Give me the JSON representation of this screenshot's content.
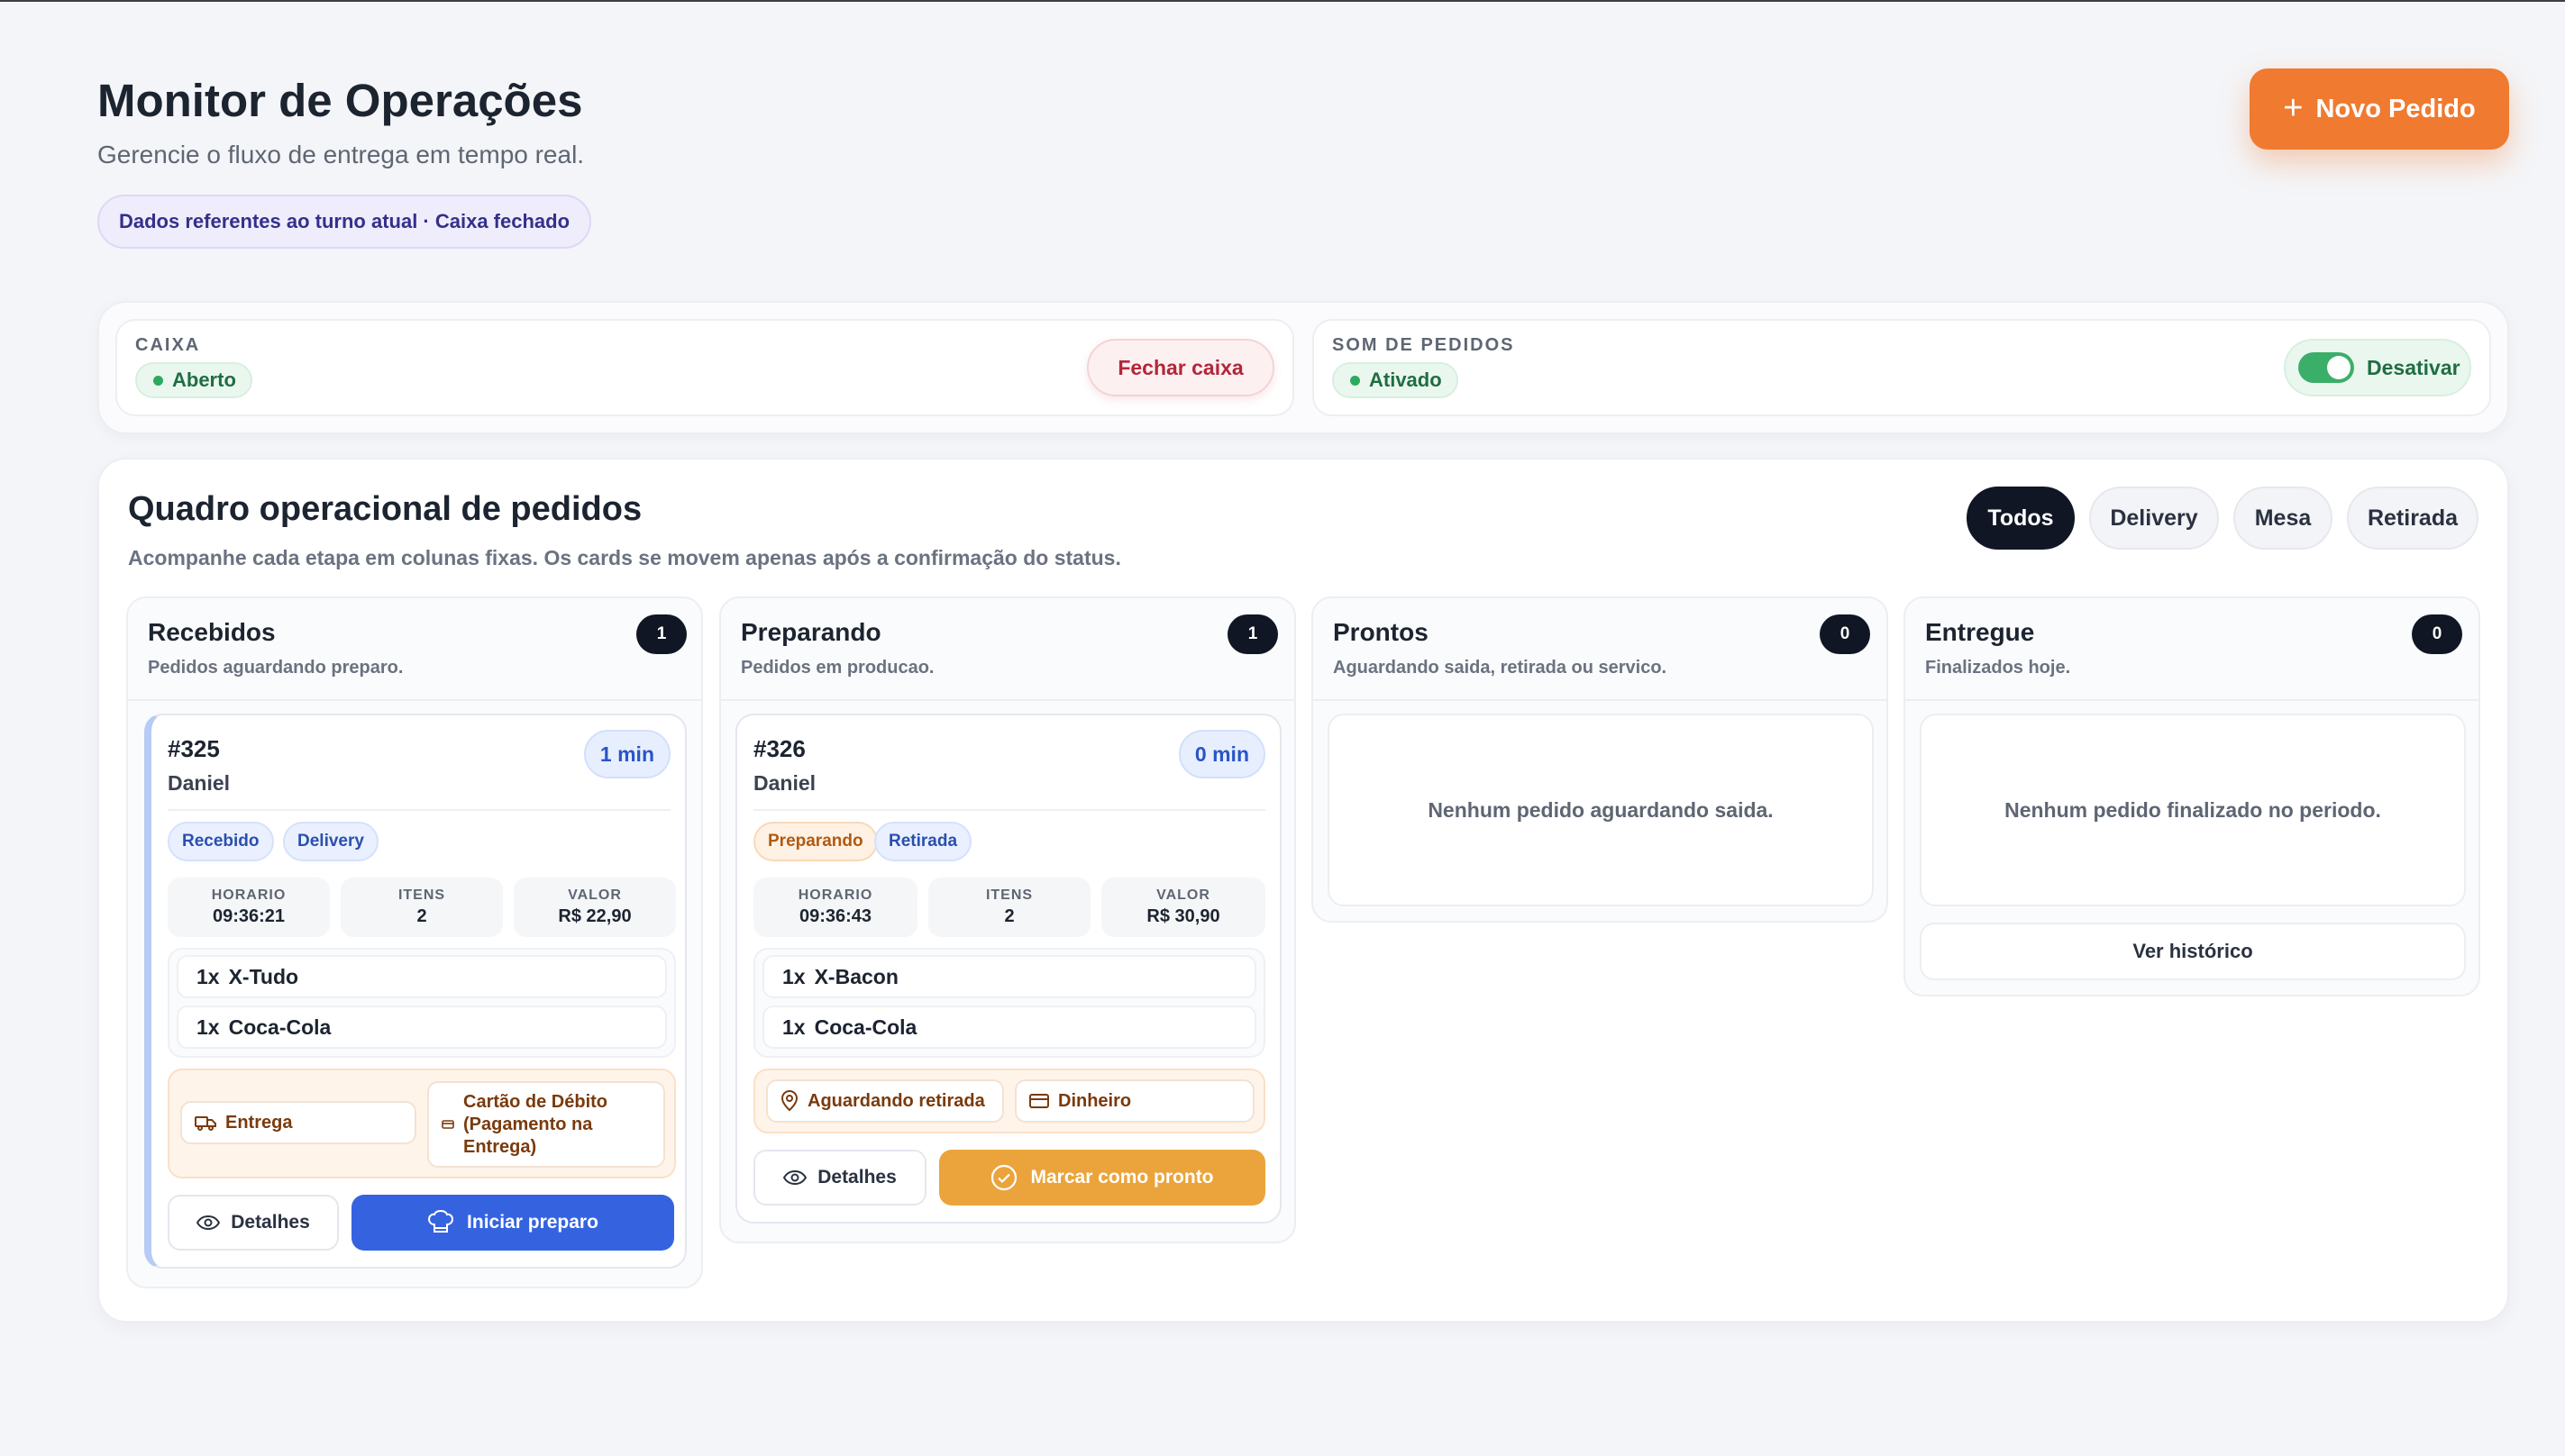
{
  "header": {
    "title": "Monitor de Operações",
    "subtitle": "Gerencie o fluxo de entrega em tempo real.",
    "shift_info": "Dados referentes ao turno atual · Caixa fechado",
    "new_order_label": "Novo Pedido"
  },
  "status": {
    "cash": {
      "label": "CAIXA",
      "state": "Aberto",
      "action_label": "Fechar caixa"
    },
    "sound": {
      "label": "SOM DE PEDIDOS",
      "state": "Ativado",
      "toggle_on": true,
      "action_label": "Desativar"
    }
  },
  "board": {
    "title": "Quadro operacional de pedidos",
    "subtitle": "Acompanhe cada etapa em colunas fixas. Os cards se movem apenas após a confirmação do status.",
    "filters": [
      {
        "label": "Todos",
        "active": true
      },
      {
        "label": "Delivery",
        "active": false
      },
      {
        "label": "Mesa",
        "active": false
      },
      {
        "label": "Retirada",
        "active": false
      }
    ],
    "columns": [
      {
        "title": "Recebidos",
        "subtitle": "Pedidos aguardando preparo.",
        "count": "1",
        "orders": [
          {
            "id": "#325",
            "customer": "Daniel",
            "elapsed": "1 min",
            "status_tag": "Recebido",
            "type_tag": "Delivery",
            "metrics": [
              {
                "label": "HORARIO",
                "value": "09:36:21"
              },
              {
                "label": "ITENS",
                "value": "2"
              },
              {
                "label": "VALOR",
                "value": "R$ 22,90"
              }
            ],
            "items": [
              {
                "qty": "1x",
                "name": "X-Tudo"
              },
              {
                "qty": "1x",
                "name": "Coca-Cola"
              }
            ],
            "delivery_info": "Entrega",
            "payment_info": "Cartão de Débito (Pagamento na Entrega)",
            "details_label": "Detalhes",
            "primary_action": "Iniciar preparo"
          }
        ]
      },
      {
        "title": "Preparando",
        "subtitle": "Pedidos em producao.",
        "count": "1",
        "orders": [
          {
            "id": "#326",
            "customer": "Daniel",
            "elapsed": "0 min",
            "status_tag": "Preparando",
            "type_tag": "Retirada",
            "metrics": [
              {
                "label": "HORARIO",
                "value": "09:36:43"
              },
              {
                "label": "ITENS",
                "value": "2"
              },
              {
                "label": "VALOR",
                "value": "R$ 30,90"
              }
            ],
            "items": [
              {
                "qty": "1x",
                "name": "X-Bacon"
              },
              {
                "qty": "1x",
                "name": "Coca-Cola"
              }
            ],
            "delivery_info": "Aguardando retirada",
            "payment_info": "Dinheiro",
            "details_label": "Detalhes",
            "primary_action": "Marcar como pronto"
          }
        ]
      },
      {
        "title": "Prontos",
        "subtitle": "Aguardando saida, retirada ou servico.",
        "count": "0",
        "empty_message": "Nenhum pedido aguardando saida."
      },
      {
        "title": "Entregue",
        "subtitle": "Finalizados hoje.",
        "count": "0",
        "empty_message": "Nenhum pedido finalizado no periodo.",
        "history_label": "Ver histórico"
      }
    ]
  },
  "colors": {
    "brand_orange": "#f07a2f",
    "accent_blue": "#3563e0",
    "ready_orange": "#eba43b",
    "success_green": "#2eaa5e",
    "danger_red": "#b3263a",
    "dark": "#101624"
  },
  "icons": {
    "new_order": "plus-icon",
    "status_dot": "status-dot-icon",
    "delivery": "truck-icon",
    "payment": "card-icon",
    "pickup": "map-pin-icon",
    "details": "eye-icon",
    "start_prep": "chef-hat-icon",
    "mark_ready": "check-circle-icon"
  }
}
